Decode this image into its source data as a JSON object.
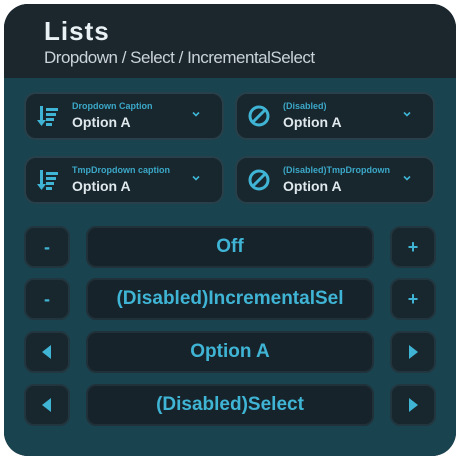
{
  "header": {
    "title": "Lists",
    "subtitle": "Dropdown / Select / IncrementalSelect"
  },
  "dropdowns": [
    {
      "caption": "Dropdown Caption",
      "value": "Option A",
      "icon": "sort-list-icon"
    },
    {
      "caption": "(Disabled)",
      "value": "Option A",
      "icon": "disabled-icon"
    },
    {
      "caption": "TmpDropdown caption",
      "value": "Option A",
      "icon": "sort-list-icon"
    },
    {
      "caption": "(Disabled)TmpDropdown",
      "value": "Option A",
      "icon": "disabled-icon"
    }
  ],
  "incremental": [
    {
      "minus": "-",
      "value": "Off",
      "plus": "+"
    },
    {
      "minus": "-",
      "value": "(Disabled)IncrementalSel",
      "plus": "+"
    }
  ],
  "selects": [
    {
      "value": "Option A"
    },
    {
      "value": "(Disabled)Select"
    }
  ],
  "colors": {
    "accent": "#3fb4d4",
    "panel": "#1e2c34",
    "body": "#1a4350"
  }
}
